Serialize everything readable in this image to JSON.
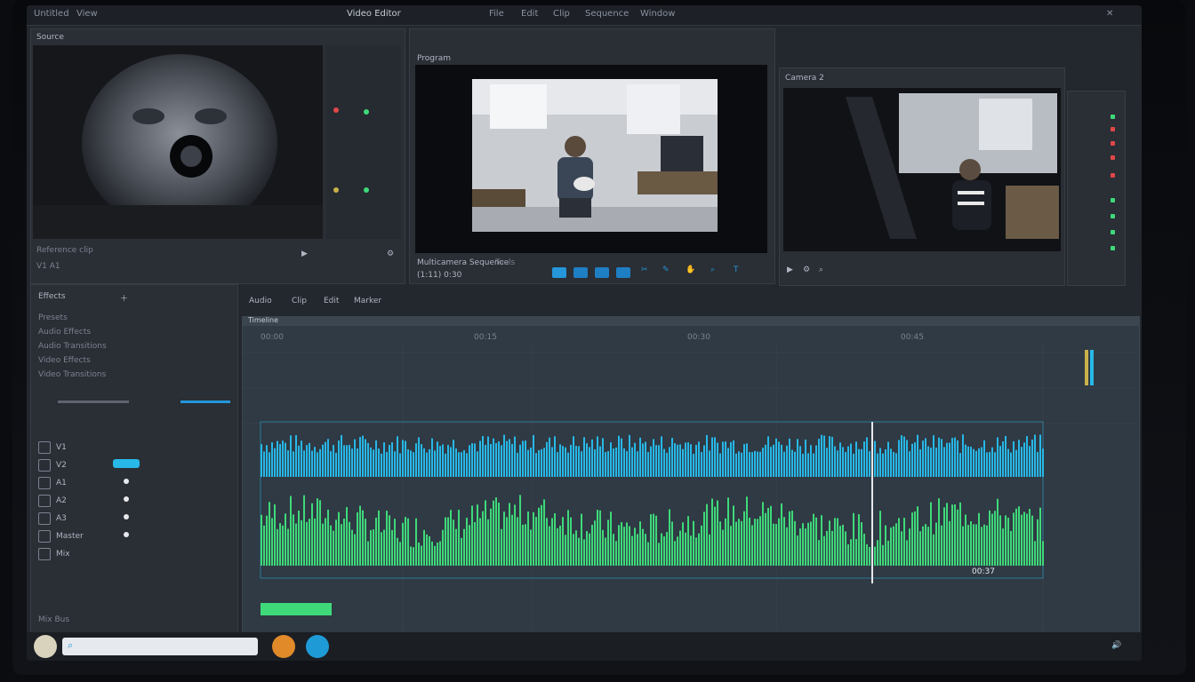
{
  "topbar": {
    "menu": [
      "Untitled",
      "View"
    ],
    "title": "Video Editor",
    "right_menu": [
      "File",
      "Edit",
      "Clip",
      "Sequence",
      "Window"
    ]
  },
  "source_panel": {
    "header": "Source",
    "clip_label": "Reference clip",
    "bin_label": "V1 A1"
  },
  "program_panel": {
    "header": "Program",
    "timecode": "(1:11) 0:30",
    "info_label": "Multicamera Sequence",
    "tools_label": "Tools"
  },
  "multicam_panel": {
    "header": "Camera 2"
  },
  "sidebar": {
    "header": "Effects",
    "items": [
      "Presets",
      "Audio Effects",
      "Audio Transitions",
      "Video Effects",
      "Video Transitions"
    ],
    "tracks": [
      "V1",
      "V2",
      "A1",
      "A2",
      "A3",
      "Master",
      "Mix"
    ],
    "footer": "Mix Bus"
  },
  "timeline": {
    "toolbar": [
      "Audio",
      "Clip",
      "Edit",
      "Marker"
    ],
    "header_label": "Timeline",
    "ruler": [
      "00:00",
      "00:15",
      "00:30",
      "00:45"
    ],
    "playhead_label": "00:37"
  },
  "colors": {
    "accent": "#2596d9",
    "wave_blue": "#27b8e8",
    "wave_green": "#3fd97a",
    "panel": "#2a2e35",
    "timeline_bg": "#2f3a44"
  },
  "icons": [
    "search-icon",
    "play-icon",
    "settings-icon",
    "crop-icon",
    "scissors-icon",
    "speaker-icon"
  ]
}
